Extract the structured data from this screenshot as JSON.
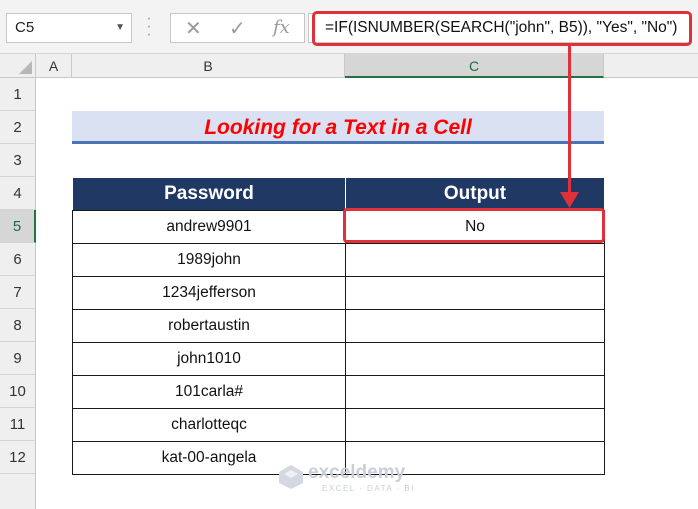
{
  "namebox": {
    "value": "C5"
  },
  "formula_bar": {
    "cancel_icon": "close-icon",
    "enter_icon": "check-icon",
    "fx_label": "fx",
    "formula": "=IF(ISNUMBER(SEARCH(\"john\", B5)), \"Yes\", \"No\")"
  },
  "columns": [
    "A",
    "B",
    "C"
  ],
  "selected_column": "C",
  "rows": [
    "1",
    "2",
    "3",
    "4",
    "5",
    "6",
    "7",
    "8",
    "9",
    "10",
    "11",
    "12"
  ],
  "selected_row": "5",
  "title": "Looking for a Text in a Cell",
  "table": {
    "headers": [
      "Password",
      "Output"
    ],
    "rows": [
      [
        "andrew9901",
        "No"
      ],
      [
        "1989john",
        ""
      ],
      [
        "1234jefferson",
        ""
      ],
      [
        "robertaustin",
        ""
      ],
      [
        "john1010",
        ""
      ],
      [
        "101carla#",
        ""
      ],
      [
        "charlotteqc",
        ""
      ],
      [
        "kat-00-angela",
        ""
      ]
    ]
  },
  "watermark": {
    "name": "exceldemy",
    "tagline": "EXCEL · DATA · BI"
  },
  "colors": {
    "header_bg": "#203864",
    "title_text": "#ff0000",
    "title_bg": "#d9e1f2",
    "highlight": "#e0303a"
  }
}
